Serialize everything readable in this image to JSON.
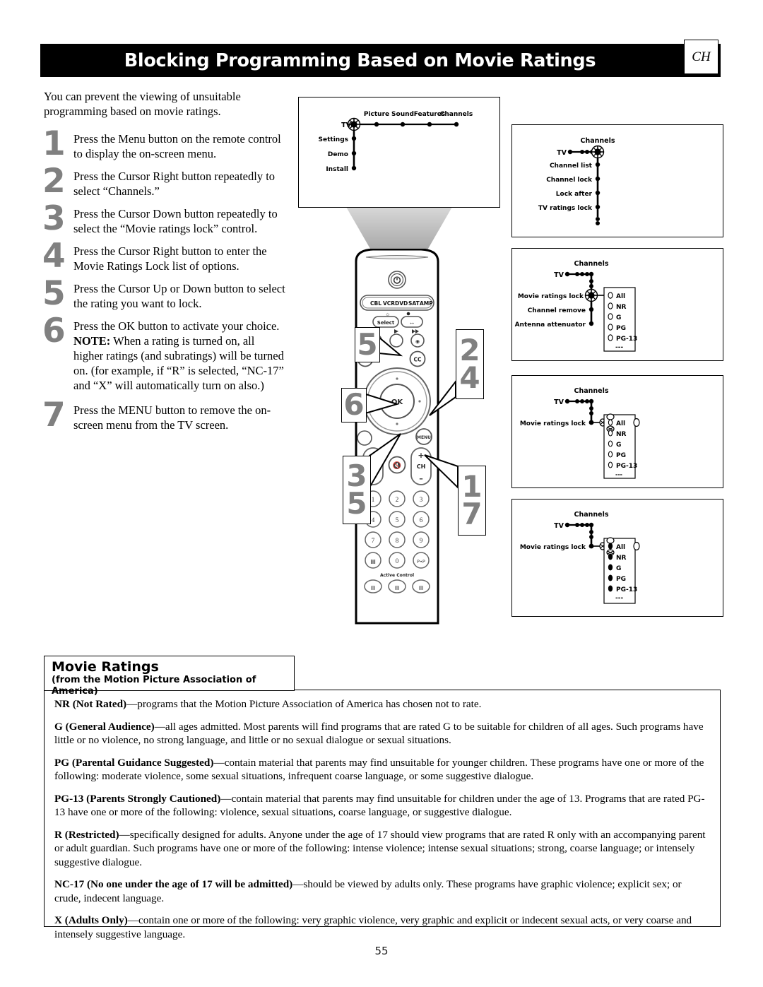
{
  "header": {
    "title": "Blocking Programming Based on Movie Ratings",
    "corner_tab": "CH"
  },
  "intro": "You can prevent the viewing of unsuitable programming based on movie ratings.",
  "steps": [
    {
      "num": "1",
      "text": "Press the Menu button on the remote control to display the on-screen menu."
    },
    {
      "num": "2",
      "text": "Press the Cursor Right button repeatedly to select “Channels.”"
    },
    {
      "num": "3",
      "text": "Press the Cursor Down button repeatedly to select the “Movie ratings lock” control."
    },
    {
      "num": "4",
      "text": "Press the Cursor Right button to enter the Movie Ratings Lock list of options."
    },
    {
      "num": "5",
      "text": "Press the Cursor Up or Down button to select the rating you want to lock."
    },
    {
      "num": "6",
      "text": "Press the OK button to activate your choice.",
      "note_label": "NOTE:",
      "note": " When a rating is turned on, all higher ratings (and subratings) will be turned on. (for example, if “R” is selected, “NC-17” and “X” will automatically turn on also.)"
    },
    {
      "num": "7",
      "text": "Press the MENU button to remove the on-screen menu from the TV screen."
    }
  ],
  "tv_menu": {
    "root": "TV",
    "horizontal_items": [
      "Picture",
      "Sound",
      "Features",
      "Channels"
    ],
    "vertical_items": [
      "Settings",
      "Demo",
      "Install"
    ]
  },
  "diagram1": {
    "root": "TV",
    "selected": "Channels",
    "items": [
      "Channel list",
      "Channel lock",
      "Lock after",
      "TV ratings lock"
    ]
  },
  "diagram2": {
    "root": "TV",
    "parent": "Channels",
    "selected": "Movie ratings lock",
    "items": [
      "Movie ratings lock",
      "Channel remove",
      "Antenna attenuator"
    ],
    "options": [
      "All",
      "NR",
      "G",
      "PG",
      "PG-13",
      "---"
    ],
    "options_state": [
      "off",
      "off",
      "off",
      "off",
      "off",
      "none"
    ]
  },
  "diagram3": {
    "root": "TV",
    "parent": "Channels",
    "selected": "Movie ratings lock",
    "highlight": "All",
    "options": [
      "All",
      "NR",
      "G",
      "PG",
      "PG-13",
      "---"
    ],
    "options_state": [
      "off",
      "off",
      "off",
      "off",
      "off",
      "none"
    ]
  },
  "diagram4": {
    "root": "TV",
    "parent": "Channels",
    "selected": "Movie ratings lock",
    "highlight": "All",
    "options": [
      "All",
      "NR",
      "G",
      "PG",
      "PG-13",
      "---"
    ],
    "options_state": [
      "on",
      "on",
      "on",
      "on",
      "on",
      "none"
    ]
  },
  "remote": {
    "power": "power-icon",
    "device_keys": [
      "CBL",
      "VCR",
      "DVD",
      "SAT",
      "AMP"
    ],
    "select_label": "Select",
    "ok_label": "OK",
    "cc_label": "CC",
    "menu_label": "MENU",
    "volume_plus": "+",
    "volume_minus": "–",
    "channel_label": "CH",
    "channel_plus": "+",
    "channel_minus": "–",
    "numbers": [
      "1",
      "2",
      "3",
      "4",
      "5",
      "6",
      "7",
      "8",
      "9",
      "0"
    ],
    "pip_label": "P•P",
    "active_control_label": "Active Control"
  },
  "callouts": [
    {
      "id": "c5",
      "values": [
        "5"
      ]
    },
    {
      "id": "c24",
      "values": [
        "2",
        "4"
      ]
    },
    {
      "id": "c6",
      "values": [
        "6"
      ]
    },
    {
      "id": "c35",
      "values": [
        "3",
        "5"
      ]
    },
    {
      "id": "c17",
      "values": [
        "1",
        "7"
      ]
    }
  ],
  "movie_ratings": {
    "title": "Movie Ratings",
    "subtitle": "(from the Motion Picture Association of America)",
    "entries": [
      {
        "term": "NR (Not Rated)",
        "desc": "—programs that the Motion Picture Association of America has chosen not to rate."
      },
      {
        "term": "G (General Audience)",
        "desc": "—all ages admitted. Most parents will find programs that are rated G to be suitable for children of all ages. Such programs have little or no violence, no strong language, and little or no sexual dialogue or sexual situations."
      },
      {
        "term": "PG (Parental Guidance Suggested)",
        "desc": "—contain material that parents may find unsuitable for younger children. These programs have one or more of the following: moderate violence, some sexual situations, infrequent coarse language, or some suggestive dialogue."
      },
      {
        "term": "PG-13 (Parents Strongly Cautioned)",
        "desc": "—contain material that parents may find unsuitable for children under the age of 13. Programs that are rated PG-13 have one or more of the following: violence, sexual situations, coarse language, or suggestive dialogue."
      },
      {
        "term": "R (Restricted)",
        "desc": "—specifically designed for adults. Anyone under the age of 17 should view programs that are rated R only with an accompanying parent or adult guardian. Such programs have one or more of the following: intense violence; intense sexual situations; strong, coarse language; or intensely suggestive dialogue."
      },
      {
        "term": "NC-17 (No one under the age of 17 will be admitted)",
        "desc": "—should be viewed by adults only. These programs have graphic violence; explicit sex; or crude, indecent language."
      },
      {
        "term": "X (Adults Only)",
        "desc": "—contain one or more of the following: very graphic violence, very graphic and explicit or indecent sexual acts, or very coarse and intensely suggestive language."
      }
    ]
  },
  "page_number": "55",
  "colors": {
    "header_bg": "#000000",
    "header_text": "#ffffff",
    "step_number": "#808080",
    "beam": "#b4b4b4"
  }
}
